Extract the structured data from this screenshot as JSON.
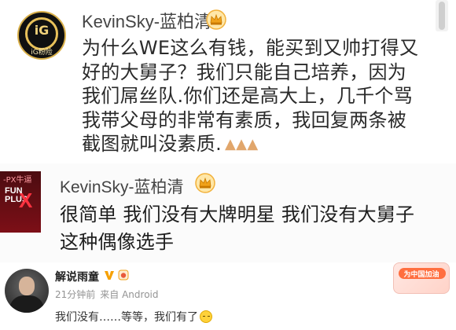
{
  "posts": [
    {
      "username": "KevinSky-蓝柏清",
      "badge_icon": "crown-icon",
      "avatar_label": "iG粉险",
      "text_lines": [
        "为什么WE这么有钱，能买到又帅打得又",
        "好的大舅子？我们只能自己培养，因为",
        "我们屌丝队.你们还是高大上，几千个骂",
        "我带父母的非常有素质，我回复两条被",
        "截图就叫没素质."
      ],
      "trailing_emoji": "clasped-hands-emoji x3"
    },
    {
      "username": "KevinSky-蓝柏清",
      "badge_icon": "crown-icon",
      "avatar_top_label": "-PX牛逼",
      "avatar_logo_text": "FUN PLUS",
      "text_lines": [
        "很简单 我们没有大牌明星 我们没有大舅子",
        "这种偶像选手"
      ]
    },
    {
      "username": "解说雨童",
      "badges": [
        "verified-v-icon",
        "medal-icon"
      ],
      "time": "21分钟前",
      "source": "来自 Android",
      "comment": "我们没有……等等，我们有了",
      "comment_emoji": "smile-emoji",
      "promo_label": "为中国加油"
    }
  ],
  "colors": {
    "username": "#444444",
    "text": "#2a2a2a",
    "meta": "#939393",
    "post2_bg": "#fbfbfb",
    "promo_accent": "#ff6e3f"
  }
}
